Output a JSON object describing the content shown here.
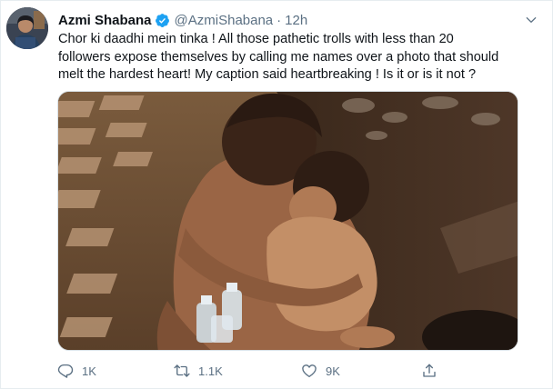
{
  "tweet": {
    "author_name": "Azmi Shabana",
    "handle": "@AzmiShabana",
    "separator": "·",
    "time": "12h",
    "text": "Chor ki daadhi mein tinka ! All those pathetic trolls with less than 20\nfollowers expose themselves by calling me names over a photo that should\nmelt the hardest heart! My caption said heartbreaking ! Is it or is it not ?",
    "verified": true
  },
  "actions": {
    "reply_count": "1K",
    "retweet_count": "1.1K",
    "like_count": "9K"
  },
  "icons": {
    "verified": "verified-badge-icon",
    "caret": "chevron-down-icon",
    "reply": "reply-icon",
    "retweet": "retweet-icon",
    "like": "heart-icon",
    "share": "share-icon"
  },
  "colors": {
    "accent": "#1da1f2",
    "secondary_text": "#5b7083",
    "primary_text": "#0f1419"
  }
}
